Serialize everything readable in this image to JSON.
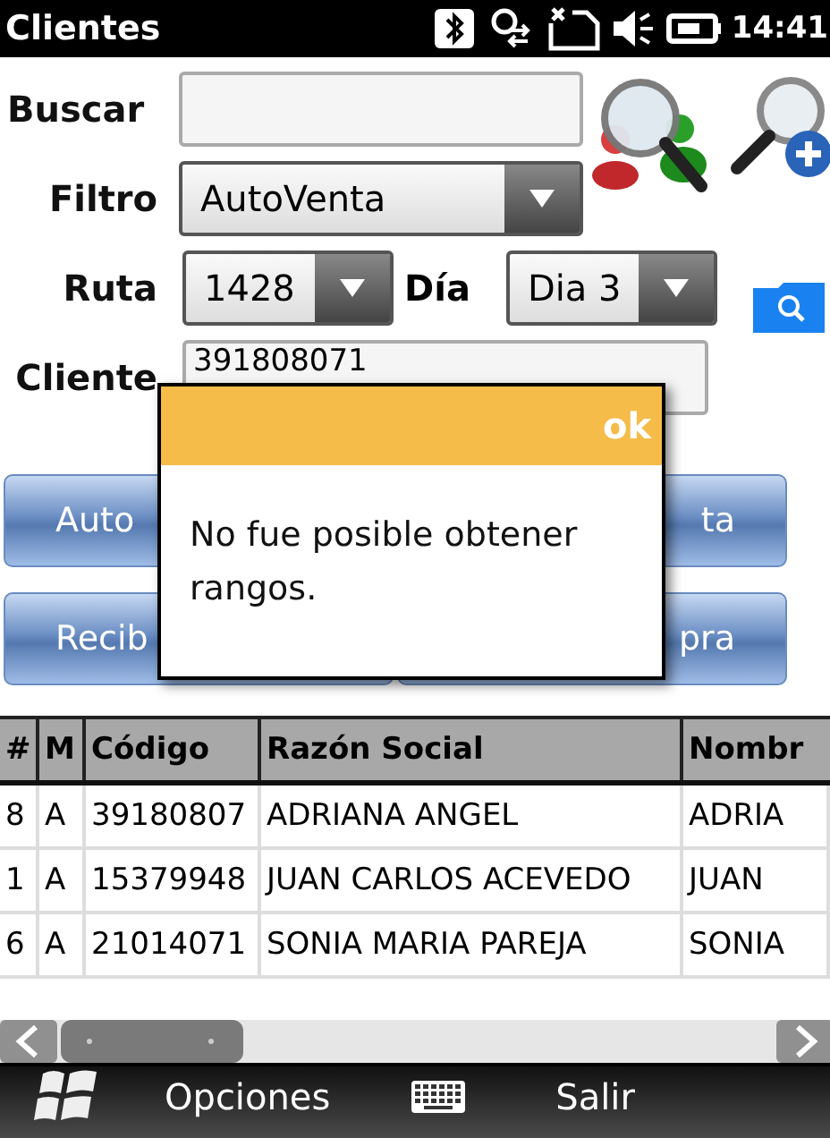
{
  "status_bar": {
    "title": "Clientes",
    "time": "14:41"
  },
  "form": {
    "buscar": {
      "label": "Buscar"
    },
    "filtro": {
      "label": "Filtro",
      "value": "AutoVenta"
    },
    "ruta": {
      "label": "Ruta",
      "value": "1428"
    },
    "dia": {
      "label": "Día",
      "value": "Dia 3"
    },
    "cliente": {
      "label": "Cliente",
      "value": "391808071"
    }
  },
  "buttons": [
    [
      "Auto",
      "ta"
    ],
    [
      "Recib",
      "pra"
    ]
  ],
  "dialog": {
    "action": "ok",
    "message": "No fue posible obtener rangos."
  },
  "table": {
    "columns": [
      "#",
      "M",
      "Código",
      "Razón Social",
      "Nombr"
    ],
    "rows": [
      [
        "8",
        "A",
        "39180807",
        "ADRIANA ANGEL",
        "ADRIA"
      ],
      [
        "1",
        "A",
        "15379948",
        "JUAN CARLOS ACEVEDO",
        "JUAN"
      ],
      [
        "6",
        "A",
        "21014071",
        "SONIA MARIA PAREJA",
        "SONIA"
      ]
    ]
  },
  "menu_bar": {
    "left": "Opciones",
    "right": "Salir"
  }
}
